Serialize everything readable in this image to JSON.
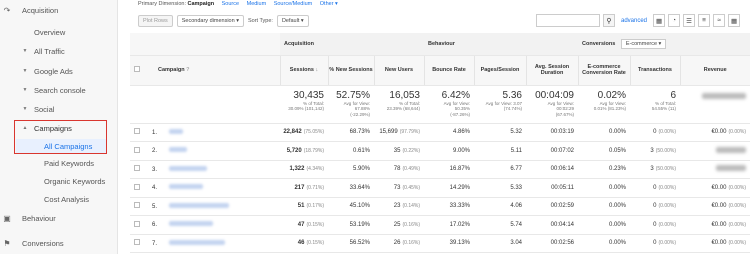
{
  "sidebar": {
    "acquisition": "Acquisition",
    "overview": "Overview",
    "all_traffic": "All Traffic",
    "google_ads": "Google Ads",
    "search_console": "Search console",
    "social": "Social",
    "campaigns": "Campaigns",
    "all_campaigns": "All Campaigns",
    "paid_keywords": "Paid Keywords",
    "organic_keywords": "Organic Keywords",
    "cost_analysis": "Cost Analysis",
    "behaviour": "Behaviour",
    "conversions": "Conversions"
  },
  "dimension_bar": {
    "label": "Primary Dimension:",
    "active": "Campaign",
    "links": [
      "Source",
      "Medium",
      "Source/Medium",
      "Other"
    ]
  },
  "controls": {
    "plot_rows": "Plot Rows",
    "secondary_dimension": "Secondary dimension",
    "sort_type_label": "Sort Type:",
    "sort_type_value": "Default",
    "advanced": "advanced"
  },
  "table": {
    "group_acquisition": "Acquisition",
    "group_behaviour": "Behaviour",
    "group_conversions": "Conversions",
    "conversions_select": "E-commerce",
    "col_campaign": "Campaign",
    "col_sessions": "Sessions",
    "col_new_sessions": "% New Sessions",
    "col_new_users": "New Users",
    "col_bounce_rate": "Bounce Rate",
    "col_pages_session": "Pages/Session",
    "col_avg_duration": "Avg. Session Duration",
    "col_ecom_rate": "E-commerce Conversion Rate",
    "col_transactions": "Transactions",
    "col_revenue": "Revenue",
    "totals": {
      "sessions": "30,435",
      "sessions_sub": "% of Total:",
      "sessions_sub2": "30.09% (101,142)",
      "new_sessions": "52.75%",
      "new_sessions_sub": "Avg for View:",
      "new_sessions_sub2": "67.88%",
      "new_sessions_sub3": "(-22.29%)",
      "new_users": "16,053",
      "new_users_sub": "% of Total:",
      "new_users_sub2": "23.39% (68,644)",
      "bounce_rate": "6.42%",
      "bounce_rate_sub": "Avg for View:",
      "bounce_rate_sub2": "50.35%",
      "bounce_rate_sub3": "(-87.26%)",
      "pages_session": "5.36",
      "pages_session_sub": "Avg for View: 3.07",
      "pages_session_sub2": "(74.74%)",
      "avg_duration": "00:04:09",
      "avg_duration_sub": "Avg for View:",
      "avg_duration_sub2": "00:02:29",
      "avg_duration_sub3": "(67.67%)",
      "ecom_rate": "0.02%",
      "ecom_rate_sub": "Avg for View:",
      "ecom_rate_sub2": "0.01% (81.23%)",
      "transactions": "6",
      "transactions_sub": "% of Total:",
      "transactions_sub2": "54.55% (11)"
    },
    "rows": [
      {
        "n": "1.",
        "sessions": "22,842",
        "sessions_pct": "(75.05%)",
        "new_sessions": "68.73%",
        "new_users": "15,699",
        "new_users_pct": "(97.79%)",
        "bounce": "4.86%",
        "pages": "5.32",
        "duration": "00:03:19",
        "ecom": "0.00%",
        "trans": "0",
        "trans_pct": "(0.00%)",
        "rev": "€0.00",
        "rev_pct": "(0.00%)"
      },
      {
        "n": "2.",
        "sessions": "5,720",
        "sessions_pct": "(18.79%)",
        "new_sessions": "0.61%",
        "new_users": "35",
        "new_users_pct": "(0.22%)",
        "bounce": "9.00%",
        "pages": "5.11",
        "duration": "00:07:02",
        "ecom": "0.05%",
        "trans": "3",
        "trans_pct": "(50.00%)",
        "rev": "",
        "rev_pct": ""
      },
      {
        "n": "3.",
        "sessions": "1,322",
        "sessions_pct": "(4.34%)",
        "new_sessions": "5.90%",
        "new_users": "78",
        "new_users_pct": "(0.49%)",
        "bounce": "16.87%",
        "pages": "6.77",
        "duration": "00:06:14",
        "ecom": "0.23%",
        "trans": "3",
        "trans_pct": "(50.00%)",
        "rev": "",
        "rev_pct": ""
      },
      {
        "n": "4.",
        "sessions": "217",
        "sessions_pct": "(0.71%)",
        "new_sessions": "33.64%",
        "new_users": "73",
        "new_users_pct": "(0.45%)",
        "bounce": "14.29%",
        "pages": "5.33",
        "duration": "00:05:11",
        "ecom": "0.00%",
        "trans": "0",
        "trans_pct": "(0.00%)",
        "rev": "€0.00",
        "rev_pct": "(0.00%)"
      },
      {
        "n": "5.",
        "sessions": "51",
        "sessions_pct": "(0.17%)",
        "new_sessions": "45.10%",
        "new_users": "23",
        "new_users_pct": "(0.14%)",
        "bounce": "33.33%",
        "pages": "4.06",
        "duration": "00:02:59",
        "ecom": "0.00%",
        "trans": "0",
        "trans_pct": "(0.00%)",
        "rev": "€0.00",
        "rev_pct": "(0.00%)"
      },
      {
        "n": "6.",
        "sessions": "47",
        "sessions_pct": "(0.15%)",
        "new_sessions": "53.19%",
        "new_users": "25",
        "new_users_pct": "(0.16%)",
        "bounce": "17.02%",
        "pages": "5.74",
        "duration": "00:04:14",
        "ecom": "0.00%",
        "trans": "0",
        "trans_pct": "(0.00%)",
        "rev": "€0.00",
        "rev_pct": "(0.00%)"
      },
      {
        "n": "7.",
        "sessions": "46",
        "sessions_pct": "(0.15%)",
        "new_sessions": "56.52%",
        "new_users": "26",
        "new_users_pct": "(0.16%)",
        "bounce": "39.13%",
        "pages": "3.04",
        "duration": "00:02:56",
        "ecom": "0.00%",
        "trans": "0",
        "trans_pct": "(0.00%)",
        "rev": "€0.00",
        "rev_pct": "(0.00%)"
      }
    ]
  }
}
